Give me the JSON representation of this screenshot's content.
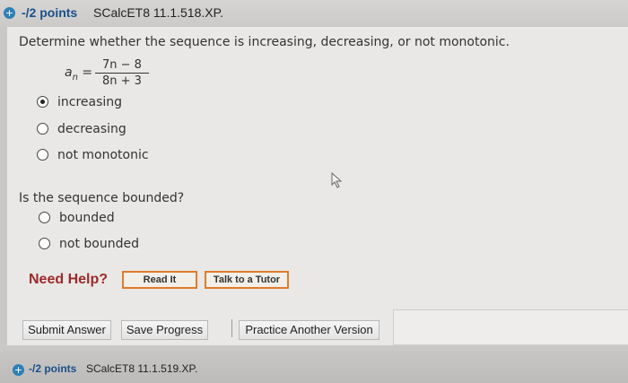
{
  "header": {
    "points": "-/2 points",
    "code": "SCalcET8 11.1.518.XP."
  },
  "question1": {
    "text": "Determine whether the sequence is increasing, decreasing, or not monotonic.",
    "formula": {
      "lhs": "a",
      "sub": "n",
      "eq": "=",
      "numerator": "7n − 8",
      "denominator": "8n + 3"
    },
    "options": [
      {
        "label": "increasing",
        "checked": true
      },
      {
        "label": "decreasing",
        "checked": false
      },
      {
        "label": "not monotonic",
        "checked": false
      }
    ]
  },
  "question2": {
    "text": "Is the sequence bounded?",
    "options": [
      {
        "label": "bounded",
        "checked": false
      },
      {
        "label": "not bounded",
        "checked": false
      }
    ]
  },
  "help": {
    "label": "Need Help?",
    "read_it": "Read It",
    "talk_tutor": "Talk to a Tutor"
  },
  "actions": {
    "submit": "Submit Answer",
    "save": "Save Progress",
    "practice": "Practice Another Version"
  },
  "next_item": {
    "points": "-/2 points",
    "code": "SCalcET8 11.1.519.XP."
  }
}
